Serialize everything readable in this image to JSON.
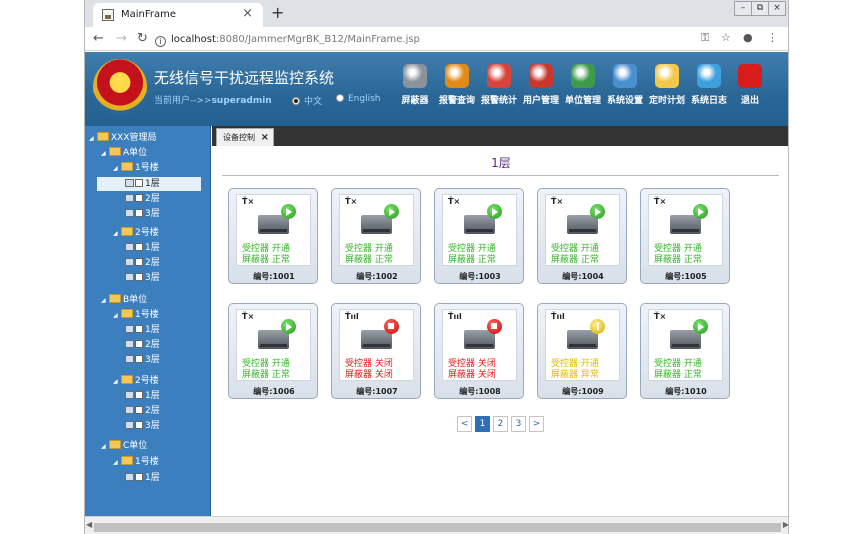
{
  "browser": {
    "tab_title": "MainFrame",
    "tab_close": "×",
    "new_tab": "+",
    "window_controls": [
      "–",
      "⧉",
      "×"
    ],
    "url_host": "localhost",
    "url_path": ":8080/JammerMgrBK_B12/MainFrame.jsp",
    "nav_icons": [
      "back-icon",
      "forward-icon",
      "reload-icon"
    ],
    "right_icons": [
      "key-icon",
      "star-icon",
      "account-icon",
      "menu-icon"
    ]
  },
  "app": {
    "title": "无线信号干扰远程监控系统",
    "current_user_label": "当前用户-->>",
    "current_user": "superadmin",
    "lang_cn": "中文",
    "lang_en": "English",
    "toolbar": [
      {
        "label": "屏蔽器",
        "icon": "jammer-icon",
        "color": "#8a929c"
      },
      {
        "label": "报警查询",
        "icon": "alarm-query-icon",
        "color": "#e08a1a"
      },
      {
        "label": "报警统计",
        "icon": "alarm-stats-icon",
        "color": "#d9443a"
      },
      {
        "label": "用户管理",
        "icon": "user-icon",
        "color": "#c9372c"
      },
      {
        "label": "单位管理",
        "icon": "unit-icon",
        "color": "#3f9b4c"
      },
      {
        "label": "系统设置",
        "icon": "settings-icon",
        "color": "#4a8fd0"
      },
      {
        "label": "定时计划",
        "icon": "clock-icon",
        "color": "#f2c84b"
      },
      {
        "label": "系统日志",
        "icon": "log-icon",
        "color": "#3fa0e0"
      },
      {
        "label": "退出",
        "icon": "exit-icon",
        "color": "#d81b1b"
      }
    ]
  },
  "tree": [
    {
      "label": "XXX管理局",
      "kind": "folder",
      "level": 0
    },
    {
      "label": "A单位",
      "kind": "folder",
      "level": 1
    },
    {
      "label": "1号楼",
      "kind": "folder",
      "level": 2
    },
    {
      "label": "1层",
      "kind": "leaf",
      "level": 3,
      "selected": true
    },
    {
      "label": "2层",
      "kind": "leaf",
      "level": 3
    },
    {
      "label": "3层",
      "kind": "leaf",
      "level": 3
    },
    {
      "label": "2号楼",
      "kind": "folder",
      "level": 2
    },
    {
      "label": "1层",
      "kind": "leaf",
      "level": 3
    },
    {
      "label": "2层",
      "kind": "leaf",
      "level": 3
    },
    {
      "label": "3层",
      "kind": "leaf",
      "level": 3
    },
    {
      "label": "B单位",
      "kind": "folder",
      "level": 1
    },
    {
      "label": "1号楼",
      "kind": "folder",
      "level": 2
    },
    {
      "label": "1层",
      "kind": "leaf",
      "level": 3
    },
    {
      "label": "2层",
      "kind": "leaf",
      "level": 3
    },
    {
      "label": "3层",
      "kind": "leaf",
      "level": 3
    },
    {
      "label": "2号楼",
      "kind": "folder",
      "level": 2
    },
    {
      "label": "1层",
      "kind": "leaf",
      "level": 3
    },
    {
      "label": "2层",
      "kind": "leaf",
      "level": 3
    },
    {
      "label": "3层",
      "kind": "leaf",
      "level": 3
    },
    {
      "label": "C单位",
      "kind": "folder",
      "level": 1
    },
    {
      "label": "1号楼",
      "kind": "folder",
      "level": 2
    },
    {
      "label": "1层",
      "kind": "leaf",
      "level": 3
    }
  ],
  "content": {
    "tab_label": "设备控制",
    "floor_title": "1层",
    "devices": [
      {
        "id": "编号:1001",
        "line1": "受控器 开通",
        "line2": "屏蔽器 正常",
        "status": "ok",
        "signal": "Ť×"
      },
      {
        "id": "编号:1002",
        "line1": "受控器 开通",
        "line2": "屏蔽器 正常",
        "status": "ok",
        "signal": "Ť×"
      },
      {
        "id": "编号:1003",
        "line1": "受控器 开通",
        "line2": "屏蔽器 正常",
        "status": "ok",
        "signal": "Ť×"
      },
      {
        "id": "编号:1004",
        "line1": "受控器 开通",
        "line2": "屏蔽器 正常",
        "status": "ok",
        "signal": "Ť×"
      },
      {
        "id": "编号:1005",
        "line1": "受控器 开通",
        "line2": "屏蔽器 正常",
        "status": "ok",
        "signal": "Ť×"
      },
      {
        "id": "编号:1006",
        "line1": "受控器 开通",
        "line2": "屏蔽器 正常",
        "status": "ok",
        "signal": "Ť×"
      },
      {
        "id": "编号:1007",
        "line1": "受控器 关闭",
        "line2": "屏蔽器 关闭",
        "status": "off",
        "signal": "Ťııl"
      },
      {
        "id": "编号:1008",
        "line1": "受控器 关闭",
        "line2": "屏蔽器 关闭",
        "status": "off",
        "signal": "Ťııl"
      },
      {
        "id": "编号:1009",
        "line1": "受控器 开通",
        "line2": "屏蔽器 异常",
        "status": "warn",
        "signal": "Ťııl"
      },
      {
        "id": "编号:1010",
        "line1": "受控器 开通",
        "line2": "屏蔽器 正常",
        "status": "ok",
        "signal": "Ť×"
      }
    ],
    "pager": {
      "prev": "<",
      "pages": [
        "1",
        "2",
        "3"
      ],
      "current": "1",
      "next": ">"
    }
  },
  "scrollbar": {
    "left": "◀",
    "right": "▶"
  }
}
